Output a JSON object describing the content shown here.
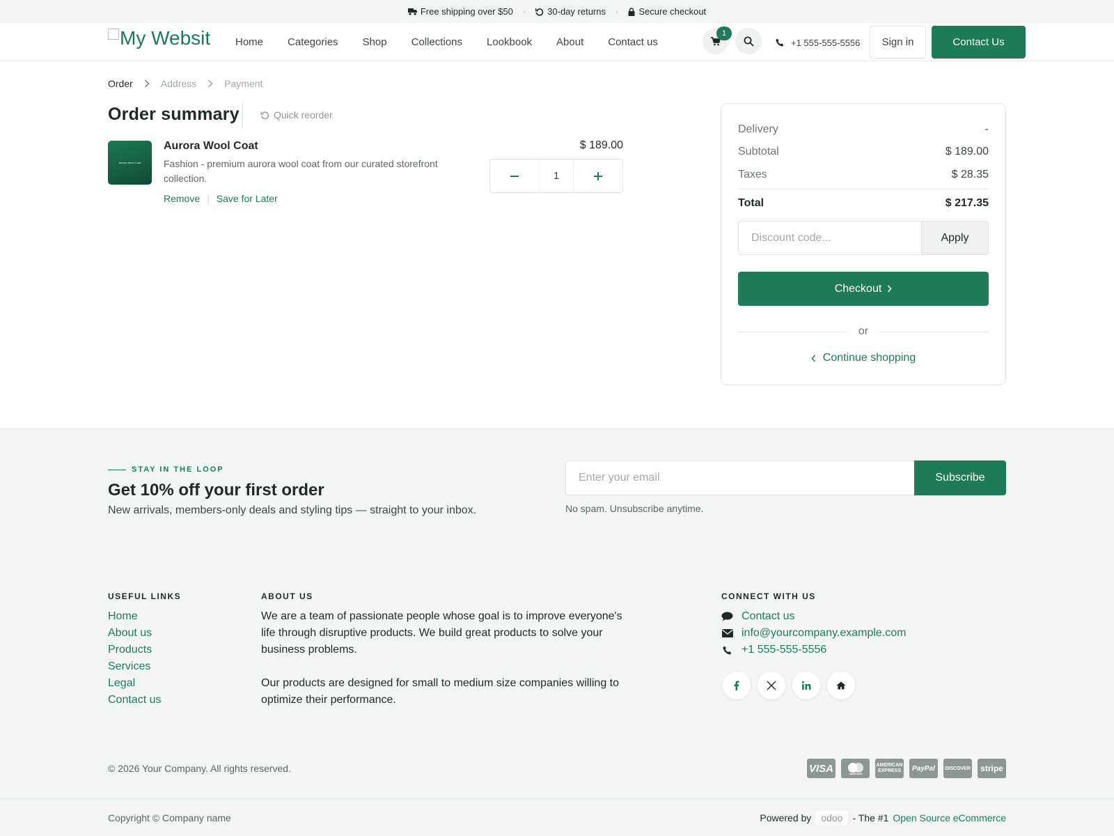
{
  "topbar": {
    "items": [
      {
        "icon": "truck-icon",
        "text": "Free shipping over $50"
      },
      {
        "icon": "rotate-icon",
        "text": "30-day returns"
      },
      {
        "icon": "lock-icon",
        "text": "Secure checkout"
      }
    ],
    "separator": "·"
  },
  "header": {
    "logo_text": "My Websit",
    "nav": [
      "Home",
      "Categories",
      "Shop",
      "Collections",
      "Lookbook",
      "About",
      "Contact us"
    ],
    "cart_count": "1",
    "phone": "+1 555-555-5556",
    "sign_in": "Sign in",
    "contact_button": "Contact Us"
  },
  "breadcrumb": {
    "steps": [
      "Order",
      "Address",
      "Payment"
    ],
    "active_step": "Order"
  },
  "order": {
    "title": "Order summary",
    "quick_reorder": "Quick reorder",
    "item": {
      "name": "Aurora Wool Coat",
      "image_caption": "Aurora Wool Coat",
      "description": "Fashion - premium aurora wool coat from our curated storefront collection.",
      "price": "$ 189.00",
      "quantity": "1",
      "remove": "Remove",
      "save_for_later": "Save for Later"
    }
  },
  "summary": {
    "delivery_label": "Delivery",
    "delivery_value": "-",
    "subtotal_label": "Subtotal",
    "subtotal_value": "$ 189.00",
    "taxes_label": "Taxes",
    "taxes_value": "$ 28.35",
    "total_label": "Total",
    "total_value": "$ 217.35",
    "discount_placeholder": "Discount code...",
    "apply": "Apply",
    "checkout": "Checkout",
    "or": "or",
    "continue_shopping": "Continue shopping"
  },
  "newsletter": {
    "eyebrow": "STAY IN THE LOOP",
    "heading": "Get 10% off your first order",
    "text": "New arrivals, members-only deals and styling tips — straight to your inbox.",
    "email_placeholder": "Enter your email",
    "subscribe": "Subscribe",
    "note": "No spam. Unsubscribe anytime."
  },
  "footer": {
    "useful_links_title": "USEFUL LINKS",
    "useful_links": [
      "Home",
      "About us",
      "Products",
      "Services",
      "Legal",
      "Contact us"
    ],
    "about_title": "ABOUT US",
    "about_p1": "We are a team of passionate people whose goal is to improve everyone's life through disruptive products. We build great products to solve your business problems.",
    "about_p2": "Our products are designed for small to medium size companies willing to optimize their performance.",
    "connect_title": "CONNECT WITH US",
    "connect_contact": "Contact us",
    "connect_email": "info@yourcompany.example.com",
    "connect_phone": "+1 555-555-5556",
    "socials": [
      "facebook-icon",
      "x-icon",
      "linkedin-icon",
      "home-icon"
    ],
    "copyright": "© 2026 Your Company. All rights reserved.",
    "payments": [
      "VISA",
      "mastercard",
      "AMERICAN EXPRESS",
      "PayPal",
      "DISCOVER",
      "stripe"
    ],
    "copyright2": "Copyright © Company name",
    "powered_by": "Powered by",
    "odoo": "odoo",
    "the_number_one": "- The #1",
    "open_source": "Open Source eCommerce"
  },
  "colors": {
    "brand": "#1f7a57",
    "text": "#1f2a27",
    "muted": "#6c7673",
    "footer_bg": "#f3f5f4"
  }
}
